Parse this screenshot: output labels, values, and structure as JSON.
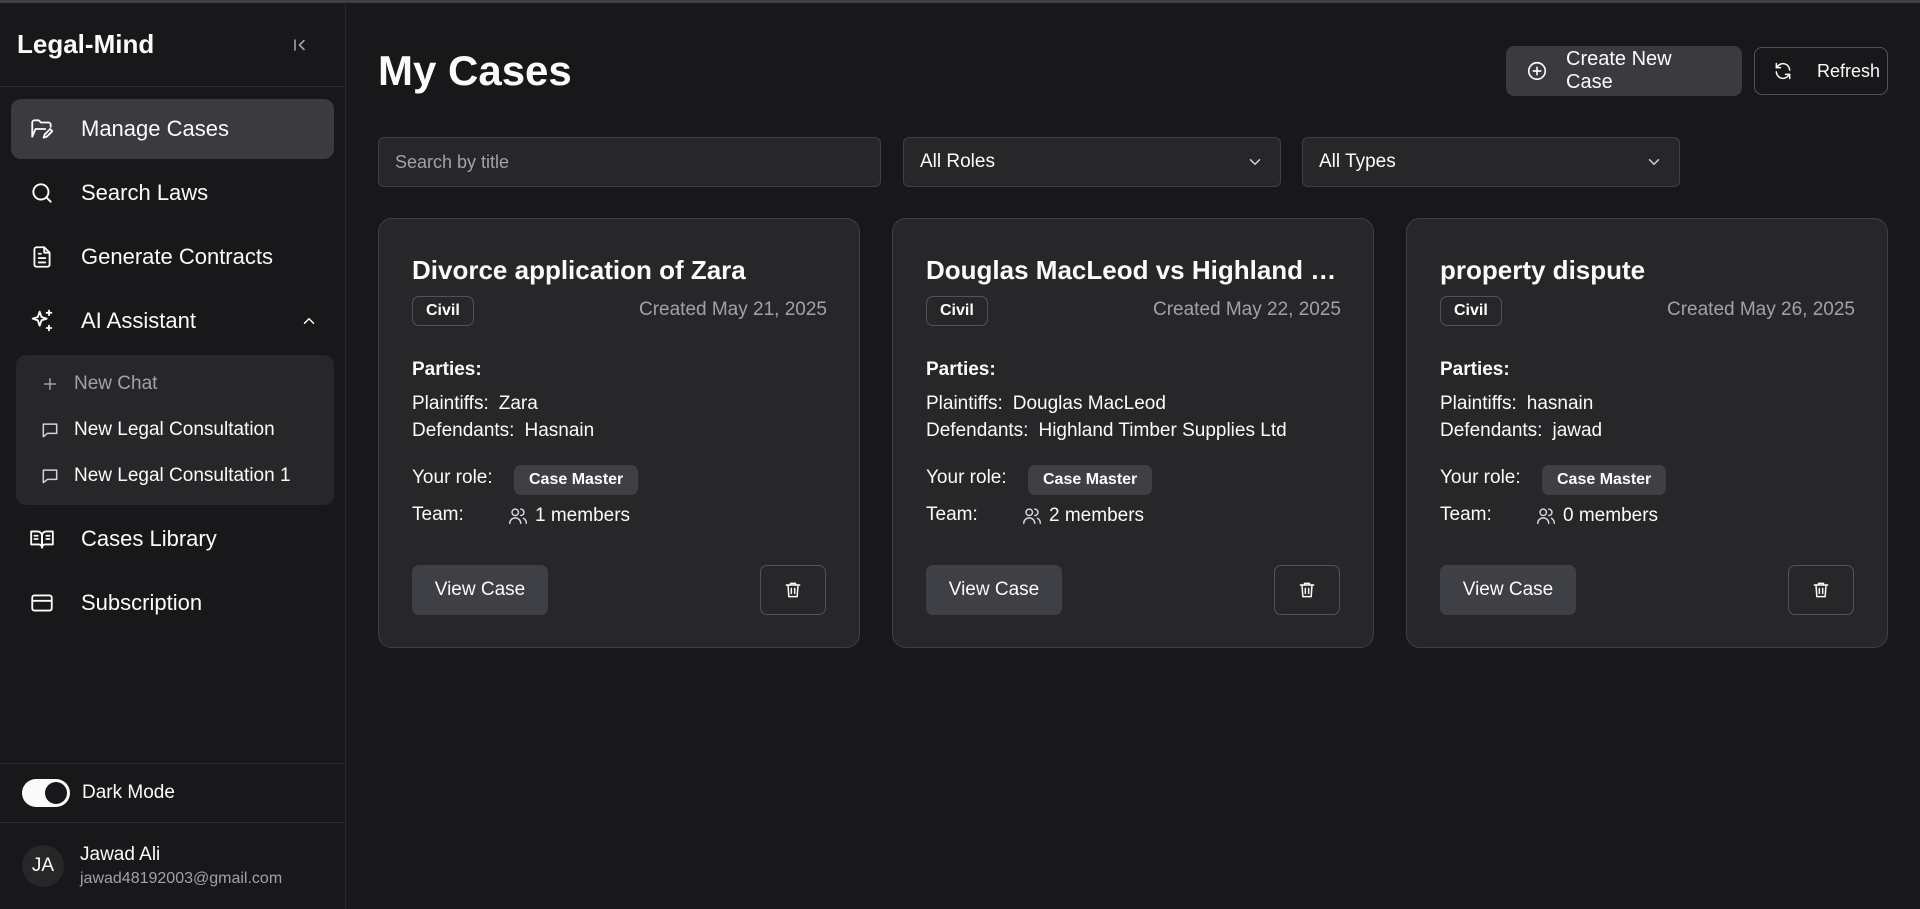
{
  "app": {
    "title": "Legal-Mind"
  },
  "sidebar": {
    "items": [
      {
        "label": "Manage Cases",
        "icon": "folder-edit-icon",
        "active": true
      },
      {
        "label": "Search Laws",
        "icon": "search-icon"
      },
      {
        "label": "Generate Contracts",
        "icon": "document-icon"
      },
      {
        "label": "AI Assistant",
        "icon": "sparkles-icon",
        "expanded": true
      },
      {
        "label": "Cases Library",
        "icon": "book-open-icon"
      },
      {
        "label": "Subscription",
        "icon": "credit-card-icon"
      }
    ],
    "ai_submenu": [
      {
        "label": "New Chat",
        "icon": "plus-icon"
      },
      {
        "label": "New Legal Consultation",
        "icon": "chat-icon"
      },
      {
        "label": "New Legal Consultation 1",
        "icon": "chat-icon"
      }
    ],
    "dark_mode_label": "Dark Mode",
    "dark_mode_on": true,
    "user": {
      "initials": "JA",
      "name": "Jawad Ali",
      "email": "jawad48192003@gmail.com"
    }
  },
  "main": {
    "title": "My Cases",
    "create_label": "Create New Case",
    "refresh_label": "Refresh",
    "search_placeholder": "Search by title",
    "role_filter": "All Roles",
    "type_filter": "All Types",
    "parties_heading": "Parties:",
    "plaintiffs_label": "Plaintiffs:",
    "defendants_label": "Defendants:",
    "role_label": "Your role:",
    "team_label": "Team:",
    "view_label": "View Case",
    "cases": [
      {
        "title": "Divorce application of Zara",
        "type": "Civil",
        "created": "Created May 21, 2025",
        "plaintiffs": "Zara",
        "defendants": "Hasnain",
        "role": "Case Master",
        "team": "1 members"
      },
      {
        "title": "Douglas MacLeod vs Highland Timber Supplies Ltd",
        "type": "Civil",
        "created": "Created May 22, 2025",
        "plaintiffs": "Douglas MacLeod",
        "defendants": "Highland Timber Supplies Ltd",
        "role": "Case Master",
        "team": "2 members"
      },
      {
        "title": "property dispute",
        "type": "Civil",
        "created": "Created May 26, 2025",
        "plaintiffs": "hasnain",
        "defendants": "jawad",
        "role": "Case Master",
        "team": "0 members"
      }
    ]
  }
}
